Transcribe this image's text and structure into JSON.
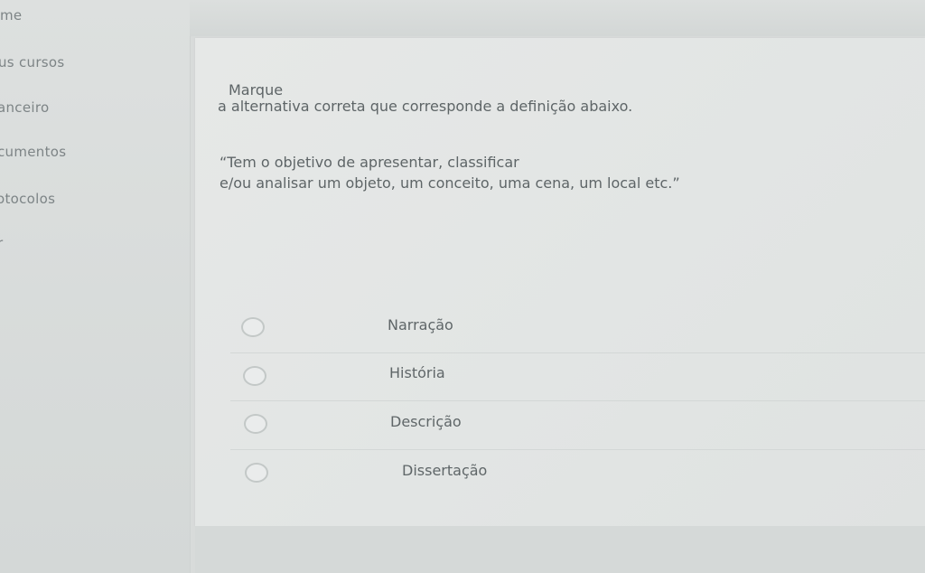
{
  "sidebar": {
    "items": [
      {
        "label": "me"
      },
      {
        "label": "us cursos"
      },
      {
        "label": "anceiro"
      },
      {
        "label": "cumentos"
      },
      {
        "label": "otocolos"
      },
      {
        "label": "r"
      }
    ]
  },
  "question": {
    "line1": "Marque",
    "line2": "a alternativa correta que corresponde a definição abaixo.",
    "quote_line1": "“Tem o objetivo de apresentar, classificar",
    "quote_line2": "e/ou analisar um objeto, um conceito, uma cena, um local etc.”"
  },
  "options": [
    {
      "label": "Narração"
    },
    {
      "label": "História"
    },
    {
      "label": "Descrição"
    },
    {
      "label": "Dissertação"
    }
  ]
}
